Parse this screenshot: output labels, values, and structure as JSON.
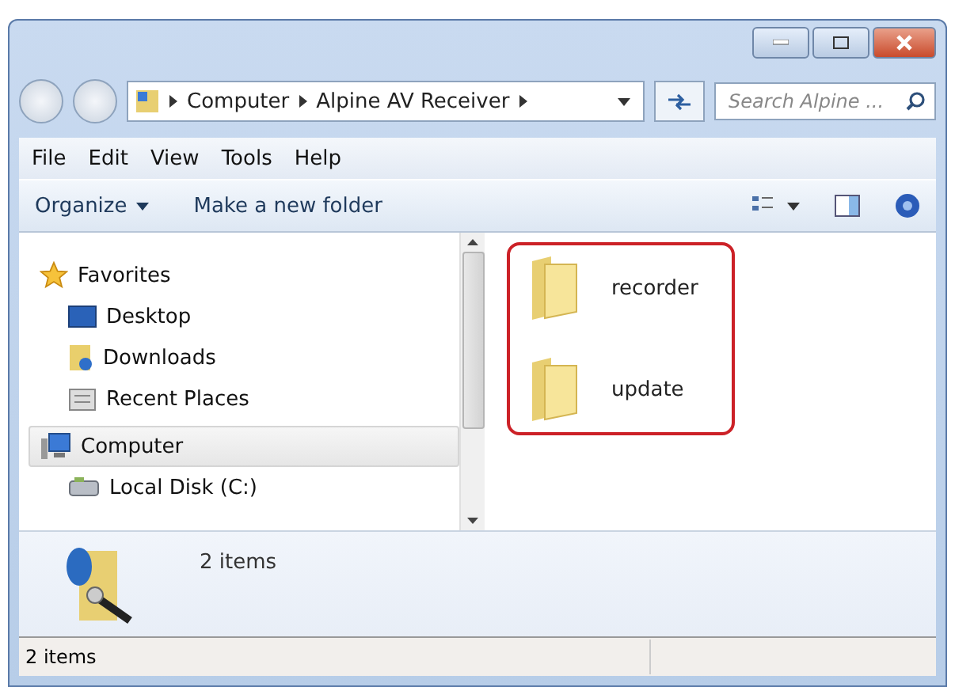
{
  "address": {
    "crumbs": [
      "Computer",
      "Alpine AV Receiver"
    ]
  },
  "search": {
    "placeholder": "Search Alpine ..."
  },
  "menu": [
    "File",
    "Edit",
    "View",
    "Tools",
    "Help"
  ],
  "toolbar": {
    "organize": "Organize",
    "new_folder": "Make a new folder"
  },
  "nav": [
    {
      "label": "Favorites",
      "kind": "star",
      "selected": false,
      "children": [
        {
          "label": "Desktop",
          "kind": "desktop",
          "selected": false
        },
        {
          "label": "Downloads",
          "kind": "downloads",
          "selected": false
        },
        {
          "label": "Recent Places",
          "kind": "recent",
          "selected": false
        }
      ]
    },
    {
      "label": "Computer",
      "kind": "computer",
      "selected": true,
      "children": [
        {
          "label": "Local Disk (C:)",
          "kind": "disk",
          "selected": false
        }
      ]
    }
  ],
  "files": [
    {
      "name": "recorder"
    },
    {
      "name": "update"
    }
  ],
  "details": {
    "count": "2 items"
  },
  "status_bar": {
    "text": "2 items"
  }
}
